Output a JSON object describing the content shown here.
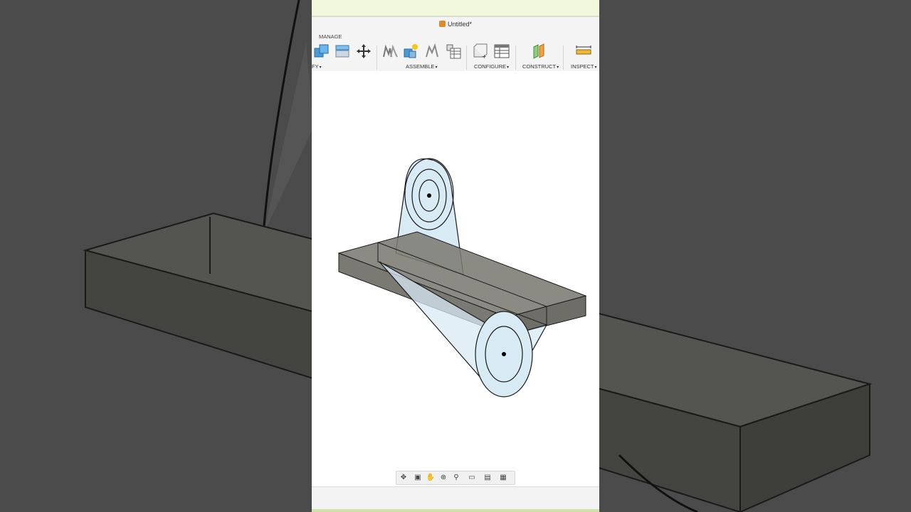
{
  "window": {
    "title": "Untitled*"
  },
  "ribbon": {
    "tab_label": "MANAGE",
    "groups": {
      "modify_partial": "FY",
      "assemble": "ASSEMBLE",
      "configure": "CONFIGURE",
      "construct": "CONSTRUCT",
      "inspect": "INSPECT"
    }
  },
  "colors": {
    "body_fill": "#7a7a72",
    "sketch_fill": "#d8eaf4",
    "title_strip": "#f2f8dc",
    "outer_background": "#4a4a4a"
  },
  "navbar": {
    "icons": [
      "orbit-icon",
      "look-at-icon",
      "pan-icon",
      "zoom-window-icon",
      "zoom-icon",
      "display-settings-icon",
      "grid-settings-icon",
      "viewports-icon"
    ]
  }
}
